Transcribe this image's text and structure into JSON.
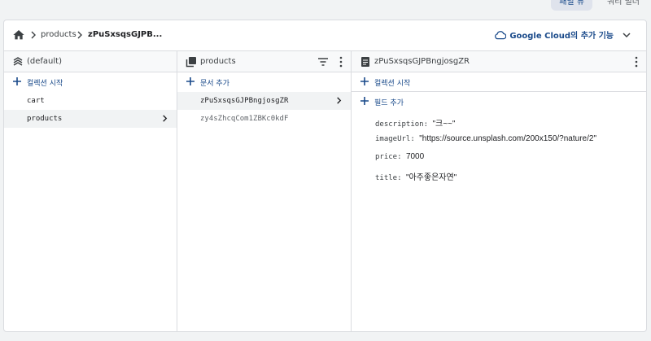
{
  "top_tabs": [
    {
      "label": "패널 뷰",
      "active": true
    },
    {
      "label": "쿼리 빌더",
      "active": false
    }
  ],
  "breadcrumb": {
    "items": [
      "products",
      "zPuSxsqsGJPB..."
    ]
  },
  "google_cloud": {
    "label": "Google Cloud의 추가 기능"
  },
  "col1": {
    "title": "(default)",
    "add_label": "컬렉션 시작",
    "items": [
      "cart",
      "products"
    ],
    "selected_index": 1
  },
  "col2": {
    "title": "products",
    "add_label": "문서 추가",
    "items": [
      "zPuSxsqsGJPBngjosgZR",
      "zy4sZhcqCom1ZBKc0kdF"
    ],
    "selected_index": 0
  },
  "col3": {
    "title": "zPuSxsqsGJPBngjosgZR",
    "add_collection_label": "컬렉션 시작",
    "add_field_label": "필드 추가",
    "fields": [
      {
        "key": "description",
        "value": "\"크~~\""
      },
      {
        "key": "imageUrl",
        "value": "\"https://source.unsplash.com/200x150/?nature/2\""
      },
      {
        "key": "price",
        "value": "7000"
      },
      {
        "key": "title",
        "value": "\"아주좋은자연\""
      }
    ]
  },
  "colors": {
    "accent": "#1a4a8a",
    "border": "#dadce0",
    "selected_bg": "#f1f3f4"
  }
}
